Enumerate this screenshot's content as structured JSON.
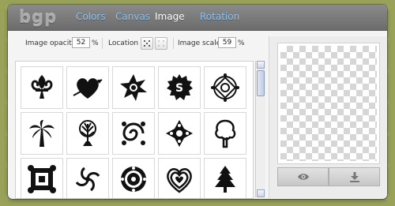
{
  "app": {
    "logo_text": "bgp"
  },
  "tabs": [
    {
      "label": "Colors",
      "active": false
    },
    {
      "label": "Canvas",
      "active": false
    },
    {
      "label": "Image",
      "active": true
    },
    {
      "label": "Rotation",
      "active": false
    }
  ],
  "controls": {
    "opacity_label": "Image opacity",
    "opacity_value": "52",
    "opacity_unit": "%",
    "location_label": "Location",
    "scale_label": "Image scale",
    "scale_value": "59",
    "scale_unit": "%"
  },
  "image_grid": [
    [
      "fleur-de-lis-icon",
      "heart-arrow-icon",
      "star-burst-icon",
      "dollar-badge-icon",
      "celtic-knot-icon"
    ],
    [
      "palm-tree-icon",
      "oak-tree-icon",
      "swirl-flourish-icon",
      "diamond-ornament-icon",
      "cartoon-tree-icon"
    ],
    [
      "square-ornament-icon",
      "spiral-icon",
      "round-ornament-icon",
      "nested-hearts-icon",
      "pine-tree-icon"
    ]
  ],
  "colors": {
    "accent_tab": "#8ec2ef",
    "background": "#9aa25a"
  },
  "preview": {
    "view_icon": "eye-icon",
    "download_icon": "download-icon"
  }
}
